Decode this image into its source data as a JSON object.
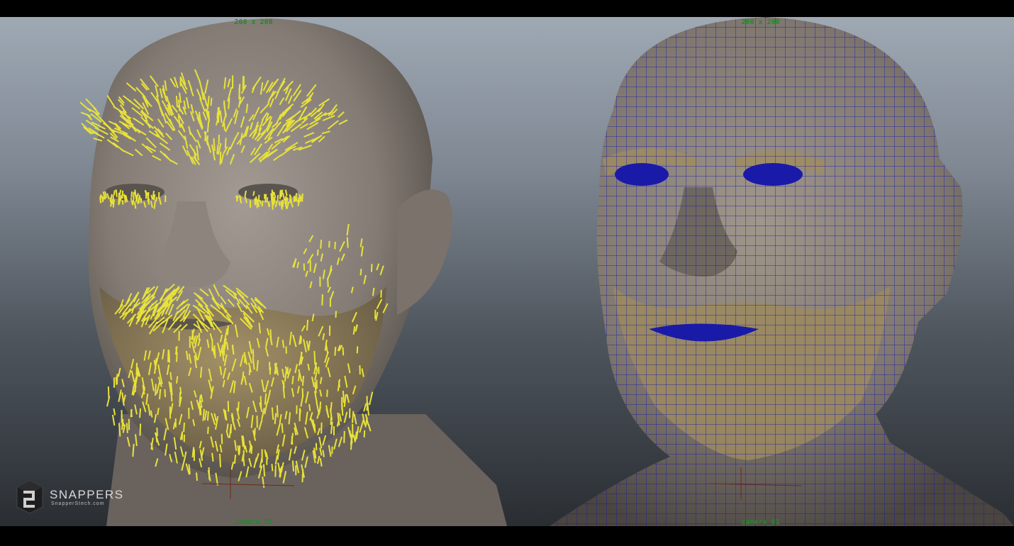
{
  "viewports": {
    "left": {
      "resolution_gate": "200 x 200",
      "camera": "camera_01"
    },
    "right": {
      "resolution_gate": "200 x 200",
      "camera": "camera_01"
    }
  },
  "logo": {
    "name": "SNAPPERS",
    "site": "SnapperStech.com"
  },
  "colors": {
    "guide_yellow": "#e8e23a",
    "wireframe_blue": "#1a1aa8",
    "hud_green": "#1f8a2a",
    "skin": "#8e867e",
    "beard": "#9c8a5e"
  },
  "icons": {
    "logo": "snappers-cube-icon"
  }
}
